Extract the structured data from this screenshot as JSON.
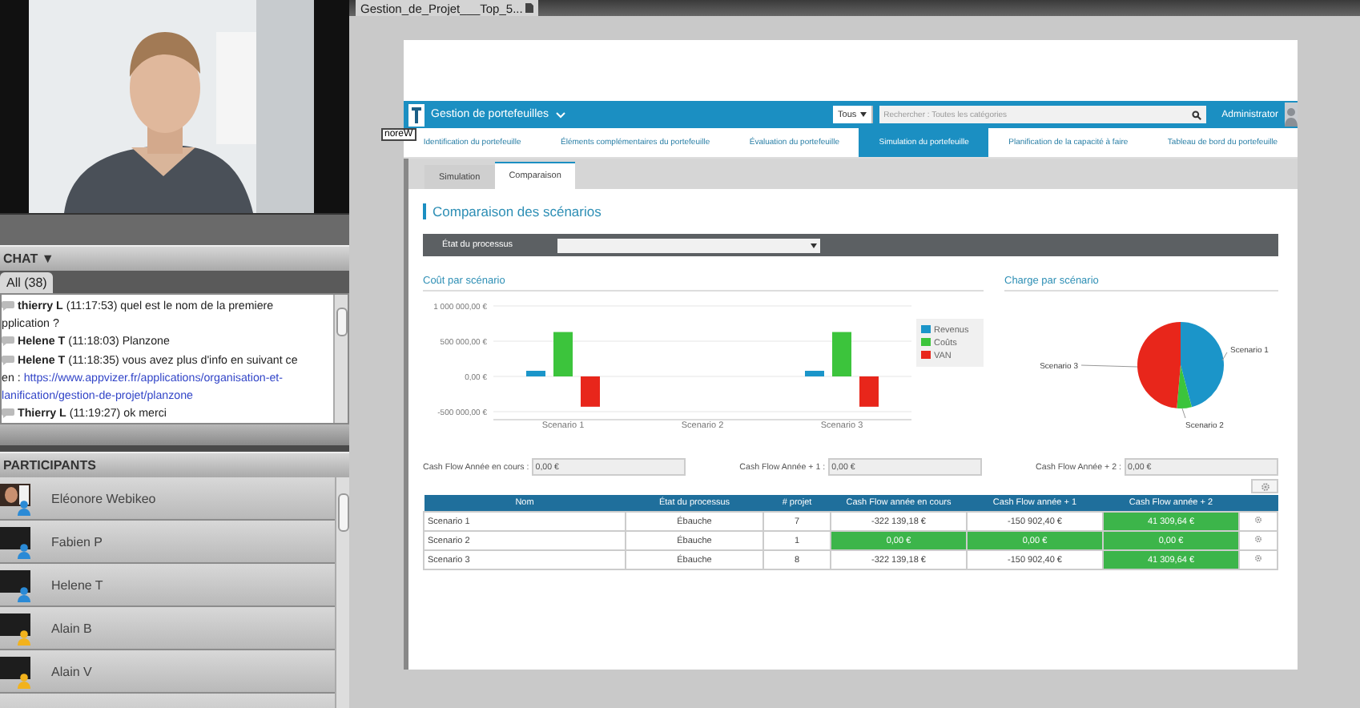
{
  "chat": {
    "title": "CHAT",
    "title_icon": "▼",
    "tabs": [
      {
        "label": "All (38)",
        "selected": true
      }
    ],
    "messages": [
      {
        "author": "thierry L",
        "text": "(11:17:53) quel est le nom de la premiere",
        "continuation": [
          [
            {
              "kind": "text",
              "text": "pplication ?"
            }
          ]
        ]
      },
      {
        "author": "Helene T",
        "text": "(11:18:03) Planzone"
      },
      {
        "author": "Helene T",
        "text": "(11:18:35) vous avez plus d'info en suivant ce",
        "continuation": [
          [
            {
              "kind": "text",
              "text": "en :"
            },
            {
              "kind": "link",
              "text": "https://www.appvizer.fr/applications/organisation-et-"
            }
          ],
          [
            {
              "kind": "link",
              "text": "lanification/gestion-de-projet/planzone"
            }
          ]
        ]
      },
      {
        "author": "Thierry L",
        "text": "(11:19:27) ok merci"
      }
    ]
  },
  "participants": {
    "title": "PARTICIPANTS",
    "items": [
      {
        "name": "Eléonore Webikeo",
        "kind": "picture",
        "color": "#2a8ad6"
      },
      {
        "name": "Fabien P",
        "kind": "blank",
        "color": "#2a8ad6"
      },
      {
        "name": "Helene T",
        "kind": "blank",
        "color": "#2a8ad6"
      },
      {
        "name": "Alain B",
        "kind": "blank",
        "color": "#f2b21c"
      },
      {
        "name": "Alain V",
        "kind": "blank",
        "color": "#f2b21c"
      }
    ]
  },
  "presentation": {
    "tab": {
      "label": "Gestion_de_Projet___Top_5..."
    },
    "cursor_label": "noreW",
    "app": {
      "title": "Gestion de portefeuilles",
      "scope": "Tous",
      "search": {
        "placeholder": "Rechercher : Toutes les catégories"
      },
      "user": "Administrator",
      "nav": [
        {
          "label": "Identification du portefeuille",
          "selected": false
        },
        {
          "label": "Éléments complémentaires du portefeuille",
          "selected": false
        },
        {
          "label": "Évaluation du portefeuille",
          "selected": false
        },
        {
          "label": "Simulation du portefeuille",
          "selected": true
        },
        {
          "label": "Planification de la capacité à faire",
          "selected": false
        },
        {
          "label": "Tableau de bord du portefeuille",
          "selected": false
        }
      ],
      "subtabs": [
        {
          "label": "Simulation",
          "selected": false
        },
        {
          "label": "Comparaison",
          "selected": true
        }
      ],
      "heading": "Comparaison des scénarios",
      "filter": {
        "label": "État du processus"
      },
      "cost_chart": {
        "title": "Coût par scénario",
        "chart_data": {
          "type": "bar",
          "categories": [
            "Scenario 1",
            "Scenario 2",
            "Scenario 3"
          ],
          "series": [
            {
              "name": "Revenus",
              "color": "#1b95c9",
              "values": [
                80000,
                0,
                80000
              ]
            },
            {
              "name": "Coûts",
              "color": "#3cc43c",
              "values": [
                630000,
                0,
                630000
              ]
            },
            {
              "name": "VAN",
              "color": "#e8261b",
              "values": [
                -430000,
                0,
                -430000
              ]
            }
          ],
          "ylim": [
            -500000,
            1000000
          ],
          "yticks": [
            {
              "value": 1000000,
              "label": "1 000 000,00 €"
            },
            {
              "value": 500000,
              "label": "500 000,00 €"
            },
            {
              "value": 0,
              "label": "0,00 €"
            },
            {
              "value": -500000,
              "label": "-500 000,00 €"
            }
          ]
        }
      },
      "load_chart": {
        "title": "Charge par scénario",
        "labels": [
          "Scenario 1",
          "Scenario 2",
          "Scenario 3"
        ]
      },
      "cash_flow_fields": [
        {
          "label": "Cash Flow Année en cours :",
          "value": "0,00 €"
        },
        {
          "label": "Cash Flow Année + 1 :",
          "value": "0,00 €"
        },
        {
          "label": "Cash Flow Année + 2 :",
          "value": "0,00 €"
        }
      ],
      "table": {
        "columns": [
          "Nom",
          "État du processus",
          "# projet",
          "Cash Flow année en cours",
          "Cash Flow année + 1",
          "Cash Flow année + 2"
        ],
        "rows": [
          {
            "name": "Scenario 1",
            "state": "Ébauche",
            "projects": "7",
            "cash_flows": [
              {
                "value": "-322 139,18 €",
                "highlighted": false
              },
              {
                "value": "-150 902,40 €",
                "highlighted": false
              },
              {
                "value": "41 309,64 €",
                "highlighted": true
              }
            ]
          },
          {
            "name": "Scenario 2",
            "state": "Ébauche",
            "projects": "1",
            "cash_flows": [
              {
                "value": "0,00 €",
                "highlighted": true
              },
              {
                "value": "0,00 €",
                "highlighted": true
              },
              {
                "value": "0,00 €",
                "highlighted": true
              }
            ]
          },
          {
            "name": "Scenario 3",
            "state": "Ébauche",
            "projects": "8",
            "cash_flows": [
              {
                "value": "-322 139,18 €",
                "highlighted": false
              },
              {
                "value": "-150 902,40 €",
                "highlighted": false
              },
              {
                "value": "41 309,64 €",
                "highlighted": true
              }
            ]
          }
        ]
      }
    }
  }
}
